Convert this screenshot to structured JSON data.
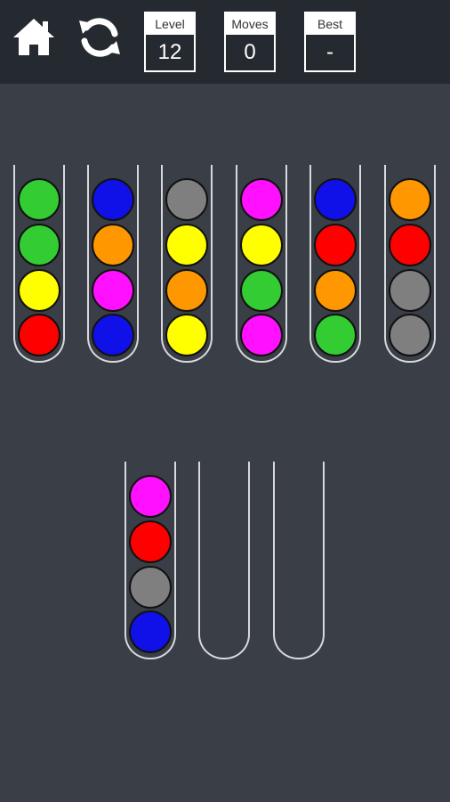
{
  "header": {
    "level_label": "Level",
    "level_value": "12",
    "moves_label": "Moves",
    "moves_value": "0",
    "best_label": "Best",
    "best_value": "-"
  },
  "icons": {
    "home": "home-icon",
    "restart": "restart-icon"
  },
  "colors": {
    "green": "#33cc33",
    "blue": "#1010e8",
    "gray": "#7f7f7f",
    "magenta": "#ff10ff",
    "orange": "#ff9800",
    "yellow": "#ffff00",
    "red": "#ff0000",
    "background": "#3a3f47",
    "topbar": "#252a31"
  },
  "tubes": [
    {
      "balls_top_to_bottom": [
        "green",
        "green",
        "yellow",
        "red"
      ]
    },
    {
      "balls_top_to_bottom": [
        "blue",
        "orange",
        "magenta",
        "blue"
      ]
    },
    {
      "balls_top_to_bottom": [
        "gray",
        "yellow",
        "orange",
        "yellow"
      ]
    },
    {
      "balls_top_to_bottom": [
        "magenta",
        "yellow",
        "green",
        "magenta"
      ]
    },
    {
      "balls_top_to_bottom": [
        "blue",
        "red",
        "orange",
        "green"
      ]
    },
    {
      "balls_top_to_bottom": [
        "orange",
        "red",
        "gray",
        "gray"
      ]
    },
    {
      "balls_top_to_bottom": [
        "magenta",
        "red",
        "gray",
        "blue"
      ]
    },
    {
      "balls_top_to_bottom": []
    },
    {
      "balls_top_to_bottom": []
    }
  ]
}
